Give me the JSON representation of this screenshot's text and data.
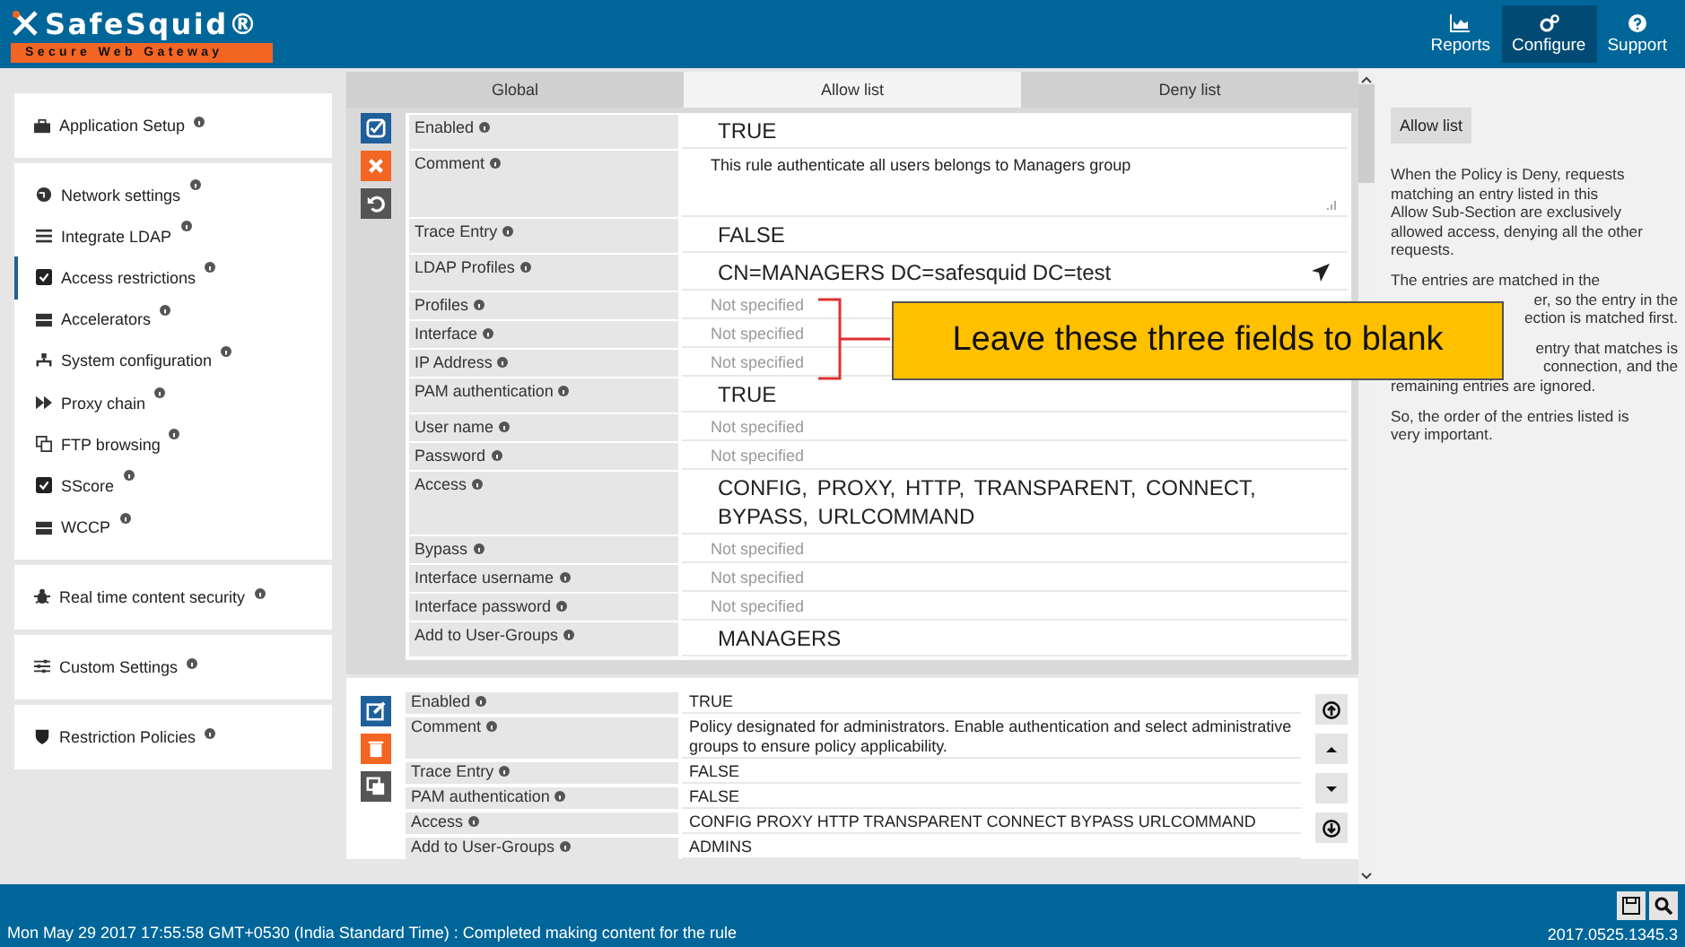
{
  "header": {
    "logo": {
      "name": "SafeSquid®",
      "tagline": "Secure Web Gateway"
    },
    "nav": [
      {
        "label": "Reports",
        "selected": false
      },
      {
        "label": "Configure",
        "selected": true
      },
      {
        "label": "Support",
        "selected": false
      }
    ]
  },
  "sidebar": {
    "groups": [
      {
        "items": [
          {
            "label": "Application Setup",
            "selected": false
          }
        ]
      },
      {
        "items": [
          {
            "label": "Network settings",
            "selected": false
          },
          {
            "label": "Integrate LDAP",
            "selected": false
          },
          {
            "label": "Access restrictions",
            "selected": true
          },
          {
            "label": "Accelerators",
            "selected": false
          },
          {
            "label": "System configuration",
            "selected": false
          },
          {
            "label": "Proxy chain",
            "selected": false
          },
          {
            "label": "FTP browsing",
            "selected": false
          },
          {
            "label": "SScore",
            "selected": false
          },
          {
            "label": "WCCP",
            "selected": false
          }
        ]
      },
      {
        "items": [
          {
            "label": "Real time content security",
            "selected": false
          }
        ]
      },
      {
        "items": [
          {
            "label": "Custom Settings",
            "selected": false
          }
        ]
      },
      {
        "items": [
          {
            "label": "Restriction Policies",
            "selected": false
          }
        ]
      }
    ]
  },
  "tabs": [
    {
      "label": "Global",
      "selected": false
    },
    {
      "label": "Allow list",
      "selected": true
    },
    {
      "label": "Deny list",
      "selected": false
    }
  ],
  "rules": [
    {
      "editing": true,
      "actions": [
        {
          "kind": "save",
          "color": "#1f5f9a"
        },
        {
          "kind": "cancel",
          "color": "#f26522"
        },
        {
          "kind": "undo",
          "color": "#555555"
        }
      ],
      "fields": [
        {
          "label": "Enabled",
          "kind": "value",
          "value": "TRUE"
        },
        {
          "label": "Comment",
          "kind": "note",
          "value": "This rule authenticate all users belongs to Managers group"
        },
        {
          "label": "Trace Entry",
          "kind": "value",
          "value": "FALSE"
        },
        {
          "label": "LDAP Profiles",
          "kind": "lookup",
          "value": "CN=MANAGERS DC=safesquid DC=test"
        },
        {
          "label": "Profiles",
          "kind": "unset",
          "placeholder": "Not specified"
        },
        {
          "label": "Interface",
          "kind": "unset",
          "placeholder": "Not specified"
        },
        {
          "label": "IP Address",
          "kind": "unset",
          "placeholder": "Not specified"
        },
        {
          "label": "PAM authentication",
          "kind": "value",
          "value": "TRUE"
        },
        {
          "label": "User name",
          "kind": "unset",
          "placeholder": "Not specified"
        },
        {
          "label": "Password",
          "kind": "unset",
          "placeholder": "Not specified"
        },
        {
          "label": "Access",
          "kind": "value",
          "value": "CONFIG,  PROXY,  HTTP,  TRANSPARENT,  CONNECT,  BYPASS,  URLCOMMAND"
        },
        {
          "label": "Bypass",
          "kind": "unset",
          "placeholder": "Not specified"
        },
        {
          "label": "Interface username",
          "kind": "unset",
          "placeholder": "Not specified"
        },
        {
          "label": "Interface password",
          "kind": "unset",
          "placeholder": "Not specified"
        },
        {
          "label": "Add to User-Groups",
          "kind": "value",
          "value": "MANAGERS"
        }
      ]
    },
    {
      "editing": false,
      "actions": [
        {
          "kind": "edit",
          "color": "#1f5f9a"
        },
        {
          "kind": "delete",
          "color": "#f26522"
        },
        {
          "kind": "copy",
          "color": "#555555"
        }
      ],
      "fields": [
        {
          "label": "Enabled",
          "kind": "value",
          "value": "TRUE"
        },
        {
          "label": "Comment",
          "kind": "value",
          "value": "Policy designated for administrators. Enable authentication and select administrative groups to ensure policy applicability."
        },
        {
          "label": "Trace Entry",
          "kind": "value",
          "value": "FALSE"
        },
        {
          "label": "PAM authentication",
          "kind": "value",
          "value": "FALSE"
        },
        {
          "label": "Access",
          "kind": "value",
          "value": "CONFIG  PROXY  HTTP  TRANSPARENT  CONNECT  BYPASS  URLCOMMAND"
        },
        {
          "label": "Add to User-Groups",
          "kind": "value",
          "value": "ADMINS"
        }
      ]
    }
  ],
  "move_buttons": [
    {
      "kind": "top"
    },
    {
      "kind": "up"
    },
    {
      "kind": "down"
    },
    {
      "kind": "bottom"
    }
  ],
  "callout": {
    "text": "Leave these three fields to blank"
  },
  "help": {
    "title": "Allow list",
    "paragraphs": [
      {
        "lines": [
          {
            "kind": "whole",
            "text": "When the Policy is Deny, requests"
          },
          {
            "kind": "whole",
            "text": "matching an entry listed in this"
          },
          {
            "kind": "whole",
            "text": "Allow Sub-Section are exclusively"
          },
          {
            "kind": "whole",
            "text": "allowed access, denying all the other"
          },
          {
            "kind": "whole",
            "text": "requests."
          }
        ]
      },
      {
        "lines": [
          {
            "kind": "whole",
            "text": "The entries are matched in the"
          },
          {
            "kind": "cut",
            "text": "er, so the entry in the"
          },
          {
            "kind": "cut",
            "text": "ection is matched first."
          }
        ]
      },
      {
        "lines": [
          {
            "kind": "cut",
            "text": "entry that matches is"
          },
          {
            "kind": "cut",
            "text": "connection, and the"
          },
          {
            "kind": "whole",
            "text": "remaining entries are ignored."
          }
        ]
      },
      {
        "lines": [
          {
            "kind": "whole",
            "text": "So, the order of the entries listed is"
          },
          {
            "kind": "whole",
            "text": "very important."
          }
        ]
      }
    ]
  },
  "status_bar": {
    "message": "Mon May 29 2017 17:55:58 GMT+0530 (India Standard Time) : Completed making content for the rule",
    "version": "2017.0525.1345.3"
  }
}
